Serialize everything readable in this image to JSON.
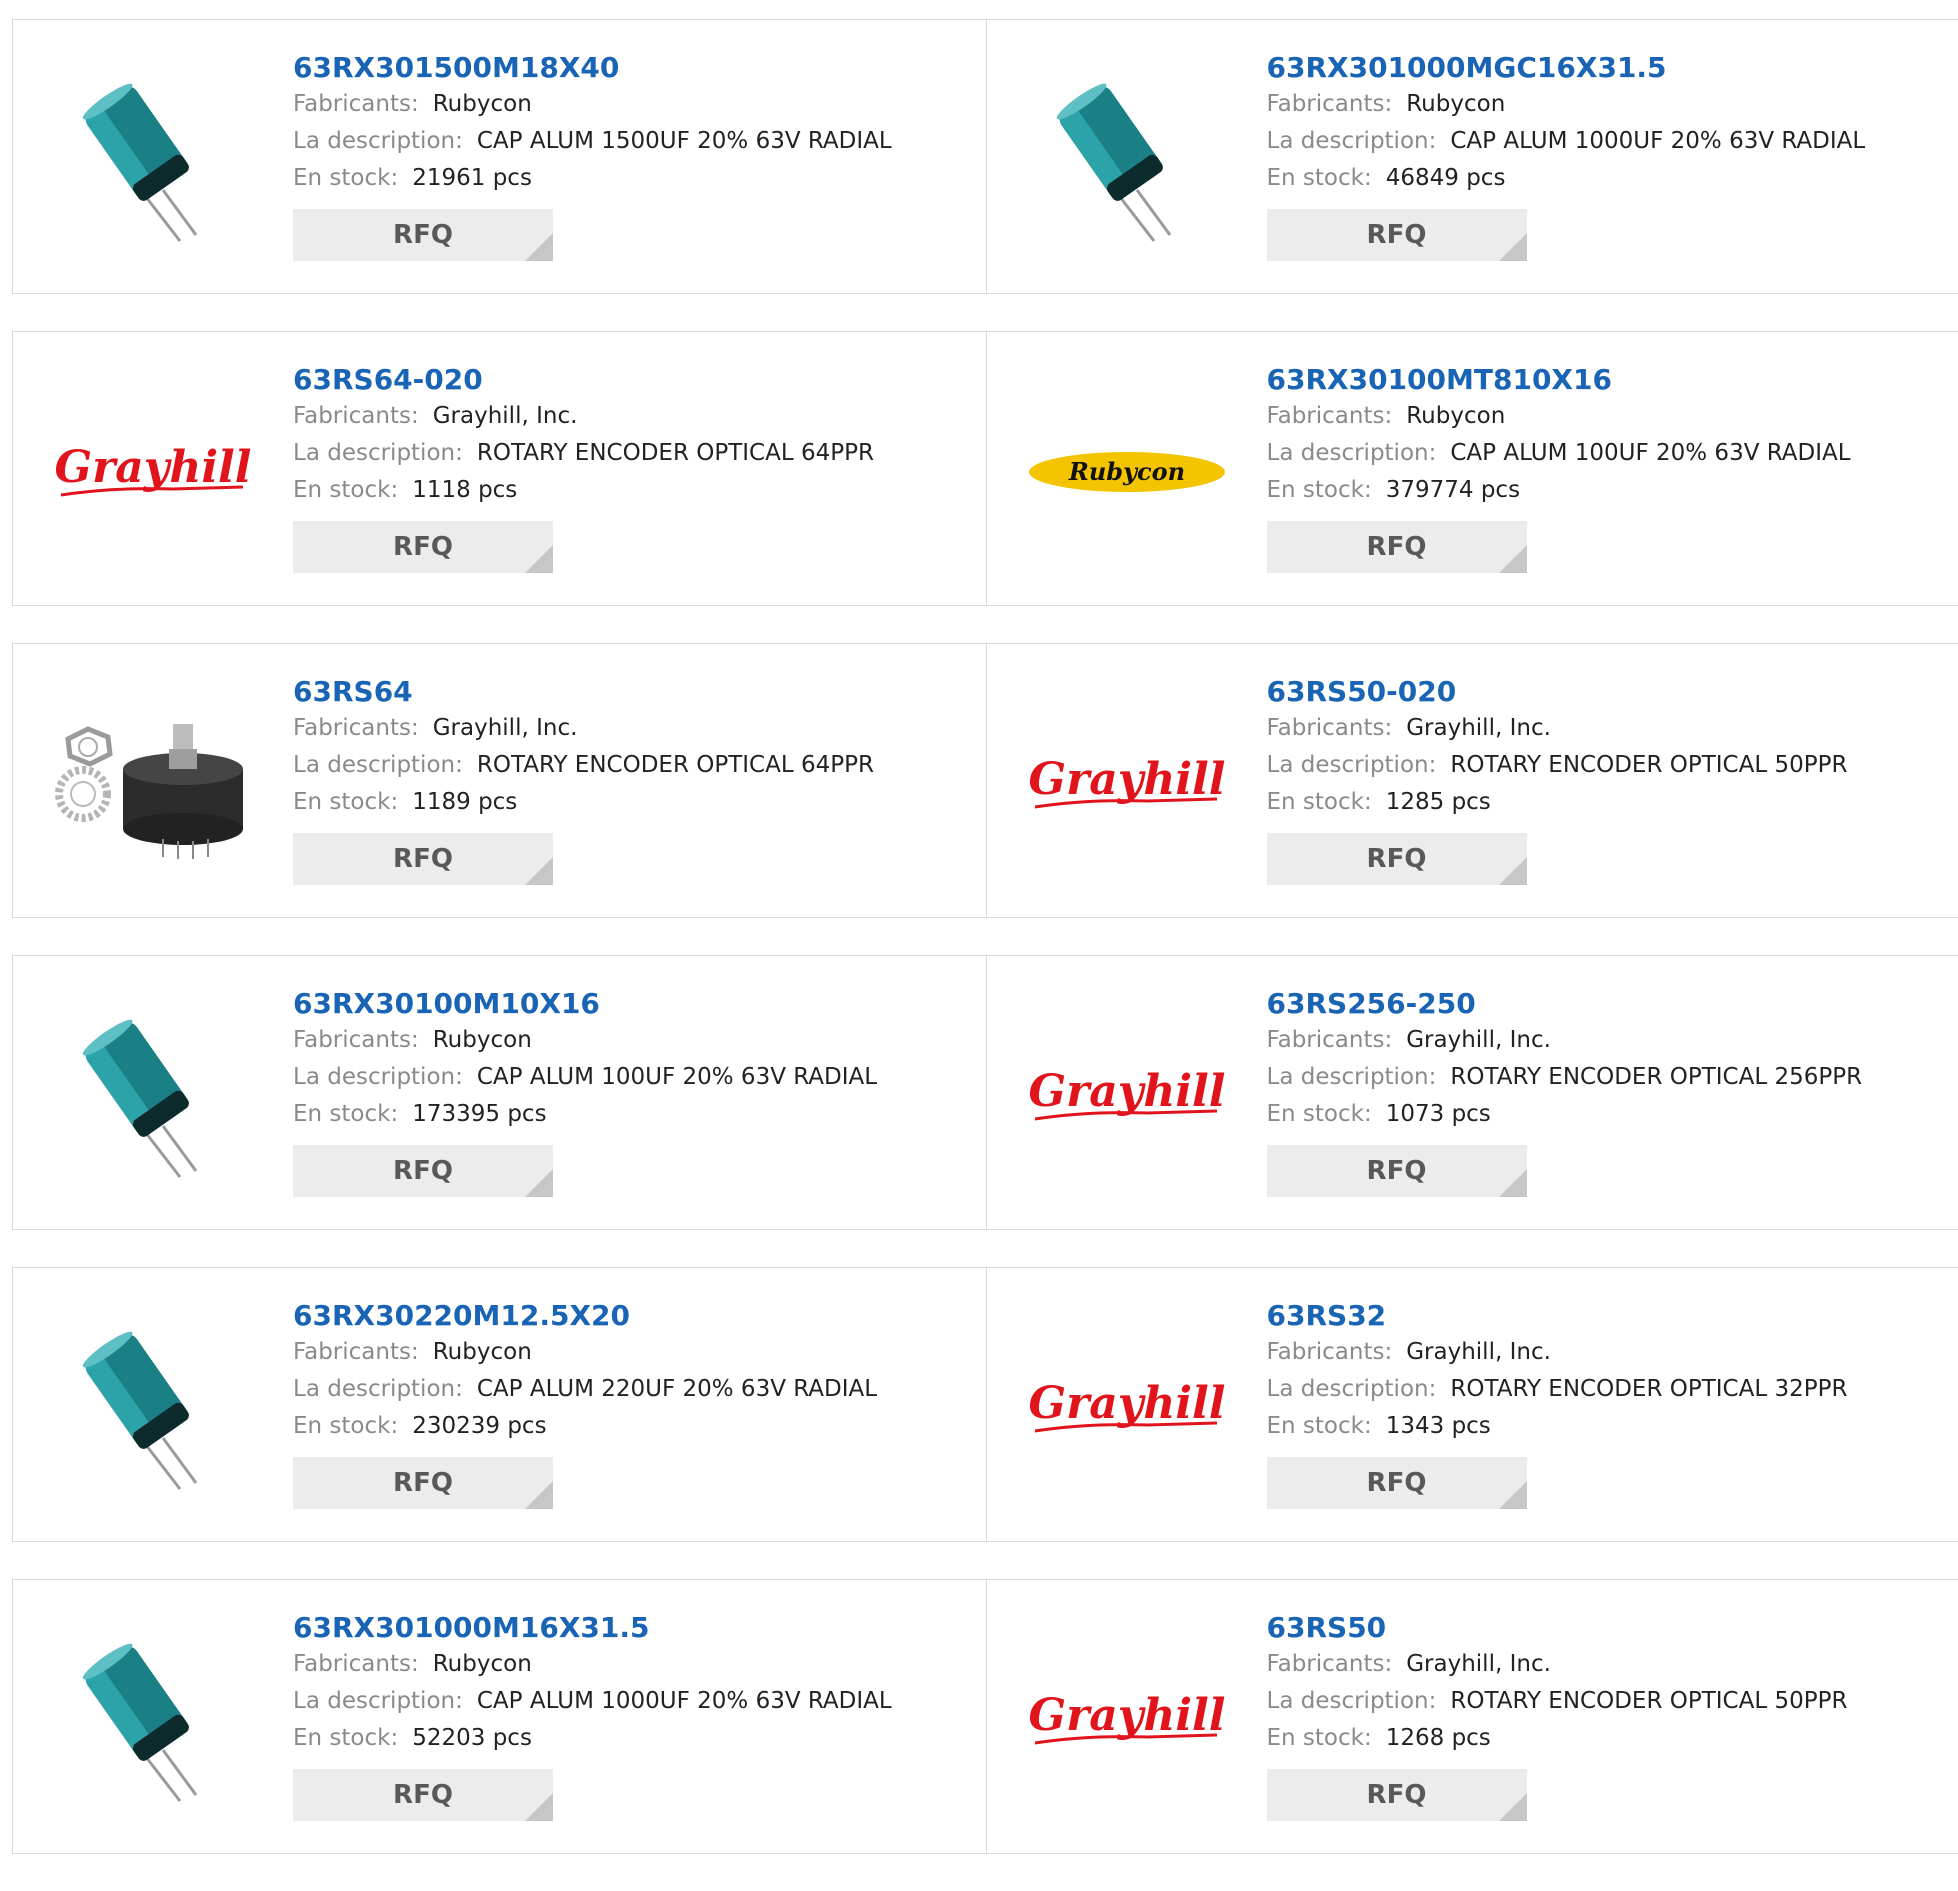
{
  "labels": {
    "manufacturer": "Fabricants:",
    "description": "La description:",
    "stock": "En stock:",
    "rfq": "RFQ"
  },
  "colors": {
    "link": "#1a64b5",
    "grayhill_red": "#e1141c",
    "rubycon_yellow": "#f5c400"
  },
  "products": [
    {
      "pn": "63RX301500M18X40",
      "mfr": "Rubycon",
      "desc": "CAP ALUM 1500UF 20% 63V RADIAL",
      "stock": "21961 pcs",
      "image": "capacitor-icon"
    },
    {
      "pn": "63RX301000MGC16X31.5",
      "mfr": "Rubycon",
      "desc": "CAP ALUM 1000UF 20% 63V RADIAL",
      "stock": "46849 pcs",
      "image": "capacitor-icon"
    },
    {
      "pn": "63RS64-020",
      "mfr": "Grayhill, Inc.",
      "desc": "ROTARY ENCODER OPTICAL 64PPR",
      "stock": "1118 pcs",
      "image": "grayhill-logo"
    },
    {
      "pn": "63RX30100MT810X16",
      "mfr": "Rubycon",
      "desc": "CAP ALUM 100UF 20% 63V RADIAL",
      "stock": "379774 pcs",
      "image": "rubycon-logo"
    },
    {
      "pn": "63RS64",
      "mfr": "Grayhill, Inc.",
      "desc": "ROTARY ENCODER OPTICAL 64PPR",
      "stock": "1189 pcs",
      "image": "rotary-encoder-icon"
    },
    {
      "pn": "63RS50-020",
      "mfr": "Grayhill, Inc.",
      "desc": "ROTARY ENCODER OPTICAL 50PPR",
      "stock": "1285 pcs",
      "image": "grayhill-logo"
    },
    {
      "pn": "63RX30100M10X16",
      "mfr": "Rubycon",
      "desc": "CAP ALUM 100UF 20% 63V RADIAL",
      "stock": "173395 pcs",
      "image": "capacitor-icon"
    },
    {
      "pn": "63RS256-250",
      "mfr": "Grayhill, Inc.",
      "desc": "ROTARY ENCODER OPTICAL 256PPR",
      "stock": "1073 pcs",
      "image": "grayhill-logo"
    },
    {
      "pn": "63RX30220M12.5X20",
      "mfr": "Rubycon",
      "desc": "CAP ALUM 220UF 20% 63V RADIAL",
      "stock": "230239 pcs",
      "image": "capacitor-icon"
    },
    {
      "pn": "63RS32",
      "mfr": "Grayhill, Inc.",
      "desc": "ROTARY ENCODER OPTICAL 32PPR",
      "stock": "1343 pcs",
      "image": "grayhill-logo"
    },
    {
      "pn": "63RX301000M16X31.5",
      "mfr": "Rubycon",
      "desc": "CAP ALUM 1000UF 20% 63V RADIAL",
      "stock": "52203 pcs",
      "image": "capacitor-icon"
    },
    {
      "pn": "63RS50",
      "mfr": "Grayhill, Inc.",
      "desc": "ROTARY ENCODER OPTICAL 50PPR",
      "stock": "1268 pcs",
      "image": "grayhill-logo"
    }
  ]
}
